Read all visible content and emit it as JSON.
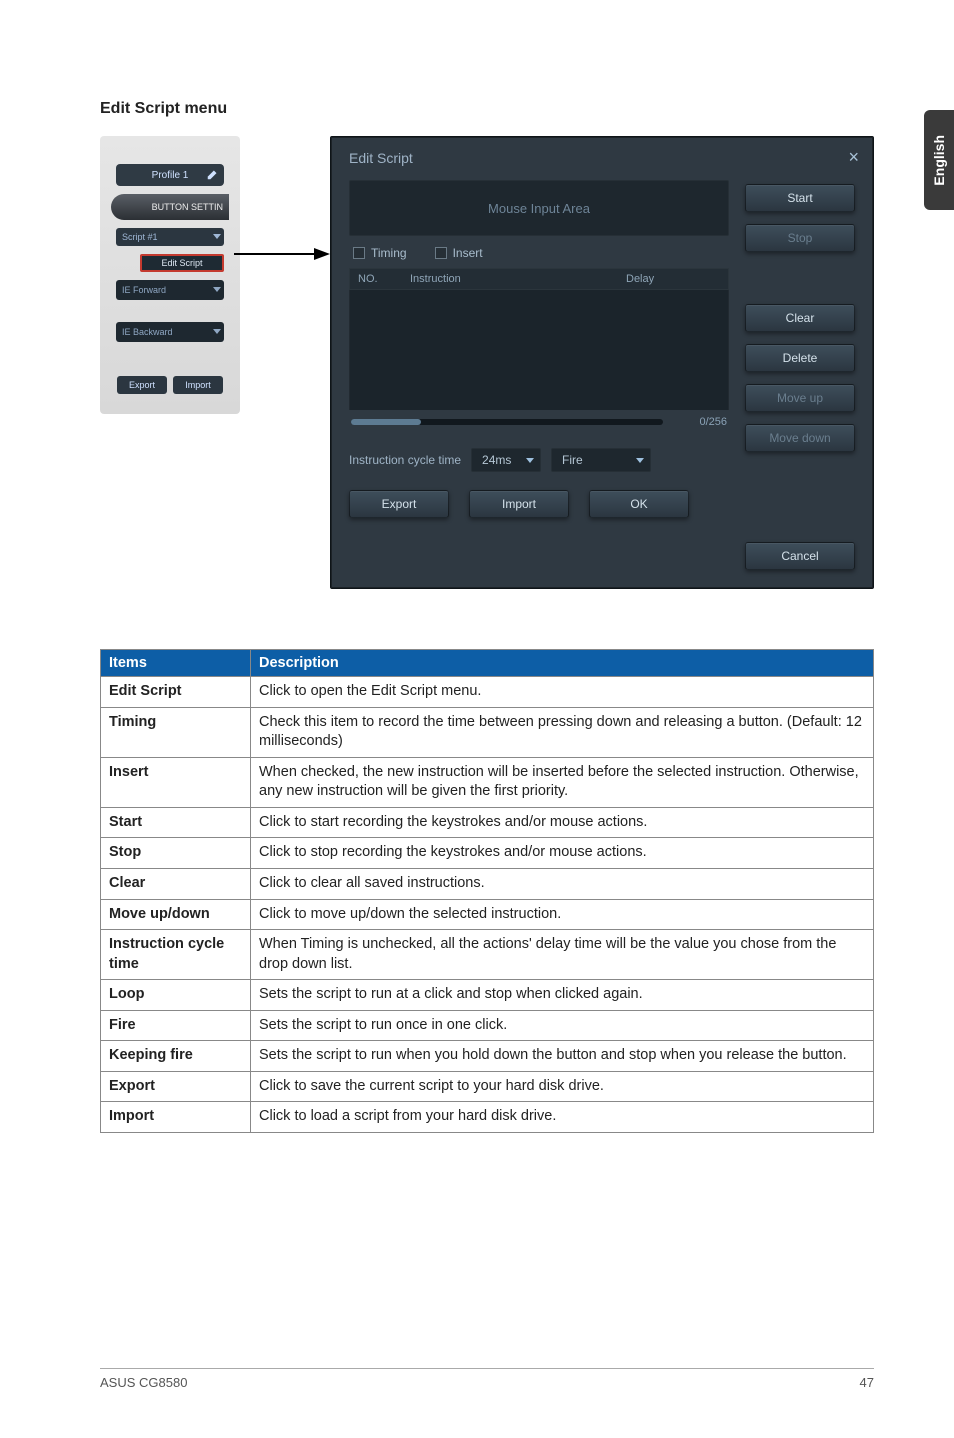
{
  "side_tab": "English",
  "section_title": "Edit Script menu",
  "left_panel": {
    "profile": "Profile 1",
    "button_settin": "BUTTON SETTIN",
    "script_drop": "Script #1",
    "edit_script": "Edit Script",
    "ie_forward": "IE Forward",
    "ie_backward": "IE Backward",
    "export": "Export",
    "import": "Import"
  },
  "dialog": {
    "title": "Edit Script",
    "close": "×",
    "mouse_input": "Mouse Input Area",
    "timing": "Timing",
    "insert": "Insert",
    "col_no": "NO.",
    "col_inst": "Instruction",
    "col_delay": "Delay",
    "counter": "0/256",
    "cycle_label": "Instruction cycle time",
    "cycle_val": "24ms",
    "fire_val": "Fire",
    "start": "Start",
    "stop": "Stop",
    "clear": "Clear",
    "delete": "Delete",
    "move_up": "Move up",
    "move_down": "Move down",
    "export": "Export",
    "import": "Import",
    "ok": "OK",
    "cancel": "Cancel"
  },
  "table": {
    "h_items": "Items",
    "h_desc": "Description",
    "rows": [
      {
        "k": "Edit Script",
        "v": "Click to open the Edit Script menu."
      },
      {
        "k": "Timing",
        "v": "Check this item to record the time between pressing down and releasing a button. (Default: 12 milliseconds)"
      },
      {
        "k": "Insert",
        "v": "When checked, the new instruction will be inserted before the selected instruction. Otherwise, any new instruction will be given the first priority."
      },
      {
        "k": "Start",
        "v": "Click to start recording the keystrokes and/or mouse actions."
      },
      {
        "k": "Stop",
        "v": "Click to stop recording the keystrokes and/or mouse actions."
      },
      {
        "k": "Clear",
        "v": "Click to clear all saved instructions."
      },
      {
        "k": "Move up/down",
        "v": "Click to move up/down the selected instruction."
      },
      {
        "k": "Instruction cycle time",
        "v": "When Timing is unchecked, all the actions' delay time will be the value you chose from the drop down list."
      },
      {
        "k": "Loop",
        "v": "Sets the script to run at a click and stop when clicked again."
      },
      {
        "k": "Fire",
        "v": "Sets the script to run once in one click."
      },
      {
        "k": "Keeping fire",
        "v": "Sets the script to run when you hold down the button and stop when you release the button."
      },
      {
        "k": "Export",
        "v": "Click to save the current script to your hard disk drive."
      },
      {
        "k": "Import",
        "v": "Click to load a script from your hard disk drive."
      }
    ]
  },
  "footer": {
    "left": "ASUS CG8580",
    "right": "47"
  }
}
